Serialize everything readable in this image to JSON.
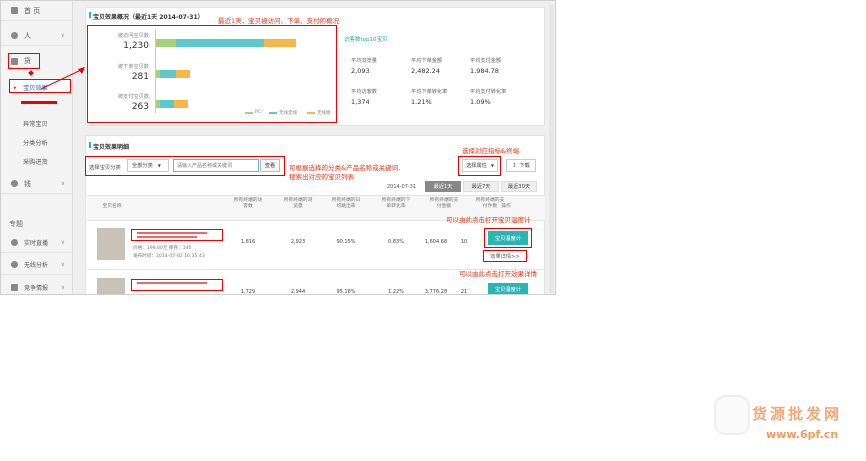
{
  "sidebar": {
    "items": [
      {
        "label": "首 页"
      },
      {
        "label": "人"
      },
      {
        "label": "货"
      },
      {
        "label": "钱"
      }
    ],
    "sub_items": [
      {
        "label": "宝贝效果"
      },
      {
        "label": "异常宝贝"
      },
      {
        "label": "分类分析"
      },
      {
        "label": "采购进货"
      }
    ],
    "section": "专题",
    "section_items": [
      {
        "label": "实时直播"
      },
      {
        "label": "无线分析"
      },
      {
        "label": "竞争情报"
      }
    ]
  },
  "overview": {
    "title": "宝贝效果概况（最近1天 2014-07-31）",
    "stats": [
      {
        "label": "被访问宝贝数",
        "value": "1,230"
      },
      {
        "label": "被下单宝贝数",
        "value": "281"
      },
      {
        "label": "被支付宝贝数",
        "value": "263"
      }
    ],
    "legend": [
      "PC",
      "无线无线",
      "无线端"
    ]
  },
  "top10": {
    "title": "访客数top10宝贝",
    "metrics": [
      {
        "label": "平均浏览量",
        "value": "2,093"
      },
      {
        "label": "平均下单金额",
        "value": "2,482.24"
      },
      {
        "label": "平均支付金额",
        "value": "1,984.78"
      },
      {
        "label": "平均访客数",
        "value": "1,374"
      },
      {
        "label": "平均下单转化率",
        "value": "1.21%"
      },
      {
        "label": "平均支付转化率",
        "value": "1.09%"
      }
    ]
  },
  "detail": {
    "title": "宝贝效果明细",
    "filter_label": "选择宝贝分类",
    "category": "全部分类",
    "search_placeholder": "请输入产品名称或关键词",
    "search_button": "查看",
    "select_indicator": "选择属性",
    "download": "下载",
    "date": "2014-07-31",
    "ranges": [
      "最近1天",
      "最近7天",
      "最近30天"
    ],
    "headers": [
      "宝贝名称",
      "所有终端的访客数",
      "所有终端的浏览量",
      "所有终端的日均跳出率",
      "所有终端的下单转化率",
      "所有终端的支付金额",
      "所有终端的支付件数",
      "操作"
    ],
    "rows": [
      {
        "price_line": "价格：199.00元  库存：140",
        "date_line": "发布时间：2014-07-02 16:35:43",
        "cells": [
          "1,816",
          "2,923",
          "90.15%",
          "0.83%",
          "1,604.68",
          "10"
        ],
        "op1": "宝贝温度计",
        "op2": "效果详情>>"
      },
      {
        "cells": [
          "1,729",
          "2,944",
          "95.16%",
          "1.22%",
          "3,776.28",
          "21"
        ],
        "op1": "宝贝温度计"
      }
    ]
  },
  "annotations": {
    "a1": "最近1天，宝贝被访问、下单、支付的概况",
    "a2_l1": "可根据选择的分类&产品名称或关键词,",
    "a2_l2": "搜索出对应的宝贝列表",
    "a3": "选择对应指标&终端",
    "a4": "可以由此点击打开宝贝温度计",
    "a5": "可以由此点击打开效果详情"
  },
  "watermark": {
    "brand": "货源批发网",
    "url": "www.6pf.cn"
  },
  "colors": {
    "accent": "#2ab5b5",
    "green": "#a8d27a",
    "teal": "#5cc9cc",
    "orange": "#f7b54a",
    "annotation": "#e31"
  }
}
